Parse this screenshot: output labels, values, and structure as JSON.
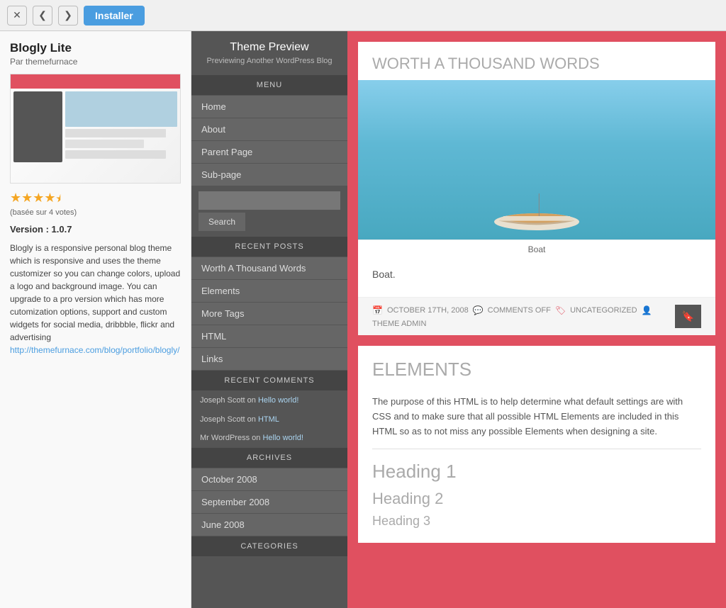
{
  "toolbar": {
    "close_label": "✕",
    "back_label": "❮",
    "forward_label": "❯",
    "install_label": "Installer"
  },
  "left_panel": {
    "theme_name": "Blogly Lite",
    "theme_author": "Par themefurnace",
    "stars": "★★★★",
    "half_star": "½",
    "rating_text": "(basée sur 4 votes)",
    "version_label": "Version : 1.0.7",
    "description": "Blogly is a responsive personal blog theme which is responsive and uses the theme customizer so you can change colors, upload a logo and background image. You can upgrade to a pro version which has more cutomization options, support and custom widgets for social media, dribbble, flickr and advertising",
    "link_text": "http://themefurnace.com/blog/portfolio/blogly/",
    "link_href": "#"
  },
  "sidebar": {
    "title": "Theme Preview",
    "subtitle": "Previewing Another WordPress Blog",
    "sections": {
      "menu": {
        "header": "MENU",
        "items": [
          {
            "label": "Home"
          },
          {
            "label": "About"
          },
          {
            "label": "Parent Page"
          },
          {
            "label": "Sub-page"
          }
        ]
      },
      "search": {
        "placeholder": "",
        "button_label": "Search"
      },
      "recent_posts": {
        "header": "RECENT POSTS",
        "items": [
          {
            "label": "Worth A Thousand Words"
          },
          {
            "label": "Elements"
          },
          {
            "label": "More Tags"
          },
          {
            "label": "HTML"
          },
          {
            "label": "Links"
          }
        ]
      },
      "recent_comments": {
        "header": "RECENT COMMENTS",
        "items": [
          {
            "author": "Joseph Scott",
            "on_text": "on",
            "link": "Hello world!"
          },
          {
            "author": "Joseph Scott",
            "on_text": "on",
            "link": "HTML"
          },
          {
            "author": "Mr WordPress",
            "on_text": "on",
            "link": "Hello world!"
          }
        ]
      },
      "archives": {
        "header": "ARCHIVES",
        "items": [
          {
            "label": "October 2008"
          },
          {
            "label": "September 2008"
          },
          {
            "label": "June 2008"
          }
        ]
      },
      "categories": {
        "header": "CATEGORIES"
      }
    }
  },
  "main_content": {
    "post1": {
      "title": "WORTH A THOUSAND WORDS",
      "image_caption": "Boat",
      "body_text": "Boat.",
      "meta_date": "OCTOBER 17TH, 2008",
      "meta_comments": "COMMENTS OFF",
      "meta_category": "UNCATEGORIZED",
      "meta_author": "THEME ADMIN"
    },
    "post2": {
      "title": "ELEMENTS",
      "body_text": "The purpose of this HTML is to help determine what default settings are with CSS and to make sure that all possible HTML Elements are included in this HTML so as to not miss any possible Elements when designing a site.",
      "heading1": "Heading 1",
      "heading2": "Heading 2",
      "heading3": "Heading 3"
    }
  }
}
